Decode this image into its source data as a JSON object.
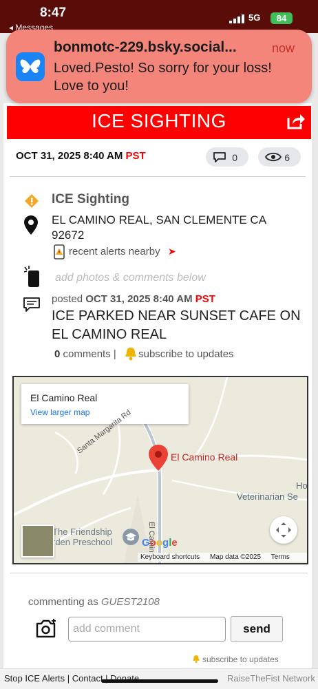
{
  "status_bar": {
    "time": "8:47",
    "back_label": "◂ Messages",
    "network": "5G",
    "battery": "84"
  },
  "notification": {
    "title": "bonmotc-229.bsky.social...",
    "time": "now",
    "body": "Loved.Pesto! So sorry for your loss! Love to you!"
  },
  "header": {
    "title": "ICE SIGHTING"
  },
  "meta": {
    "date": "OCT 31, 2025 8:40 AM",
    "tz": "PST",
    "comment_count": "0",
    "view_count": "6"
  },
  "details": {
    "type": "ICE Sighting",
    "address": "EL CAMINO REAL, SAN CLEMENTE CA 92672",
    "nearby_label": "recent alerts nearby",
    "nearby_arrow": "➤",
    "add_photos": "add photos & comments below",
    "posted_prefix": "posted",
    "posted_date": "OCT 31, 2025 8:40 AM",
    "posted_tz": "PST",
    "report": "ICE PARKED NEAR SUNSET CAFE ON EL CAMINO REAL",
    "comments_count": "0",
    "comments_label": "comments",
    "separator": "|",
    "subscribe_label": "subscribe to updates"
  },
  "map": {
    "place_name": "El Camino Real",
    "view_larger": "View larger map",
    "pin_label": "El Camino Real",
    "street_1": "Santa Margarita Rd",
    "street_2": "El Camino",
    "poi_vet": "Veterinarian Se",
    "poi_ho": "Ho",
    "poi_school_1": "The Friendship",
    "poi_school_2": "rden Preschool",
    "google_logo": "Google",
    "keyboard_shortcuts": "Keyboard shortcuts",
    "map_data": "Map data ©2025",
    "terms": "Terms"
  },
  "comment_form": {
    "commenting_as": "commenting as",
    "username": "GUEST2108",
    "placeholder": "add comment",
    "send_label": "send",
    "subscribe_label": "subscribe to updates"
  },
  "footer": {
    "links": "Stop ICE Alerts | Contact | Donate",
    "brand": "RaiseTheFist Network"
  },
  "colors": {
    "alert_red": "#ff0000",
    "notification_bg": "#f3857a",
    "status_bar": "#5a0c08",
    "bluesky_blue": "#1b84f5"
  }
}
